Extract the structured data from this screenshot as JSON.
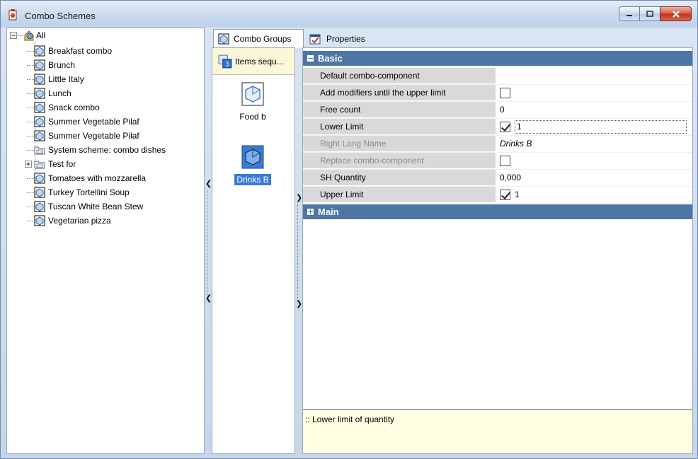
{
  "window": {
    "title": "Combo Schemes",
    "icon": "combo-schemes-app-icon",
    "buttons": [
      "minimize",
      "maximize",
      "close"
    ]
  },
  "tree": {
    "root_label": "All",
    "items": [
      {
        "label": "Breakfast combo",
        "icon": "combo-icon"
      },
      {
        "label": "Brunch",
        "icon": "combo-icon"
      },
      {
        "label": "Little Italy",
        "icon": "combo-icon"
      },
      {
        "label": "Lunch",
        "icon": "combo-icon"
      },
      {
        "label": "Snack combo",
        "icon": "combo-icon"
      },
      {
        "label": "Summer Vegetable Pilaf",
        "icon": "combo-icon"
      },
      {
        "label": "Summer Vegetable Pilaf",
        "icon": "combo-icon"
      },
      {
        "label": "System scheme: combo dishes",
        "icon": "folder-icon"
      },
      {
        "label": "Test for",
        "icon": "folder-icon",
        "expandable": true
      },
      {
        "label": "Tomatoes with mozzarella",
        "icon": "combo-icon"
      },
      {
        "label": "Turkey Tortellini Soup",
        "icon": "combo-icon"
      },
      {
        "label": "Tuscan White Bean Stew",
        "icon": "combo-icon"
      },
      {
        "label": "Vegetarian pizza",
        "icon": "combo-icon"
      }
    ]
  },
  "tabs": {
    "combo_groups": "Combo Groups",
    "properties": "Properties"
  },
  "middle": {
    "sequence_tab": "Items sequ...",
    "items": [
      {
        "label": "Food b",
        "selected": false
      },
      {
        "label": "Drinks B",
        "selected": true
      }
    ]
  },
  "properties": {
    "categories": {
      "basic": "Basic",
      "main": "Main"
    },
    "rows": [
      {
        "name": "Default combo-component",
        "value": "",
        "type": "text"
      },
      {
        "name": "Add modifiers until the upper limit",
        "value": "",
        "type": "checkbox",
        "checked": false
      },
      {
        "name": "Free count",
        "value": "0",
        "type": "text"
      },
      {
        "name": "Lower Limit",
        "value": "1",
        "type": "checkbox-edit",
        "checked": true
      },
      {
        "name": "Right Lang Name",
        "value": "Drinks B",
        "type": "italic",
        "disabled": true
      },
      {
        "name": "Replace combo-component",
        "value": "",
        "type": "checkbox",
        "checked": false,
        "disabled": true
      },
      {
        "name": "SH Quantity",
        "value": "0,000",
        "type": "text"
      },
      {
        "name": "Upper Limit",
        "value": "1",
        "type": "checkbox",
        "checked": true
      }
    ]
  },
  "help": {
    "text": ":: Lower limit of quantity"
  },
  "colors": {
    "category_bar": "#4d76a4",
    "selection": "#3a7bd5",
    "help_background": "#ffffe1"
  }
}
